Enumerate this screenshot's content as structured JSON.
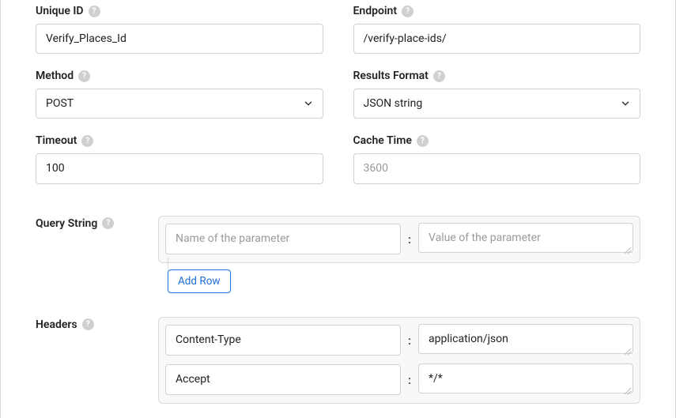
{
  "fields": {
    "uniqueId": {
      "label": "Unique ID",
      "value": "Verify_Places_Id"
    },
    "endpoint": {
      "label": "Endpoint",
      "value": "/verify-place-ids/"
    },
    "method": {
      "label": "Method",
      "value": "POST"
    },
    "resultsFormat": {
      "label": "Results Format",
      "value": "JSON string"
    },
    "timeout": {
      "label": "Timeout",
      "value": "100"
    },
    "cacheTime": {
      "label": "Cache Time",
      "placeholder": "3600",
      "value": ""
    }
  },
  "queryString": {
    "label": "Query String",
    "namePlaceholder": "Name of the parameter",
    "valuePlaceholder": "Value of the parameter",
    "addRowLabel": "Add Row"
  },
  "headers": {
    "label": "Headers",
    "rows": [
      {
        "name": "Content-Type",
        "value": "application/json"
      },
      {
        "name": "Accept",
        "value": "*/*"
      }
    ]
  },
  "colon": ":"
}
